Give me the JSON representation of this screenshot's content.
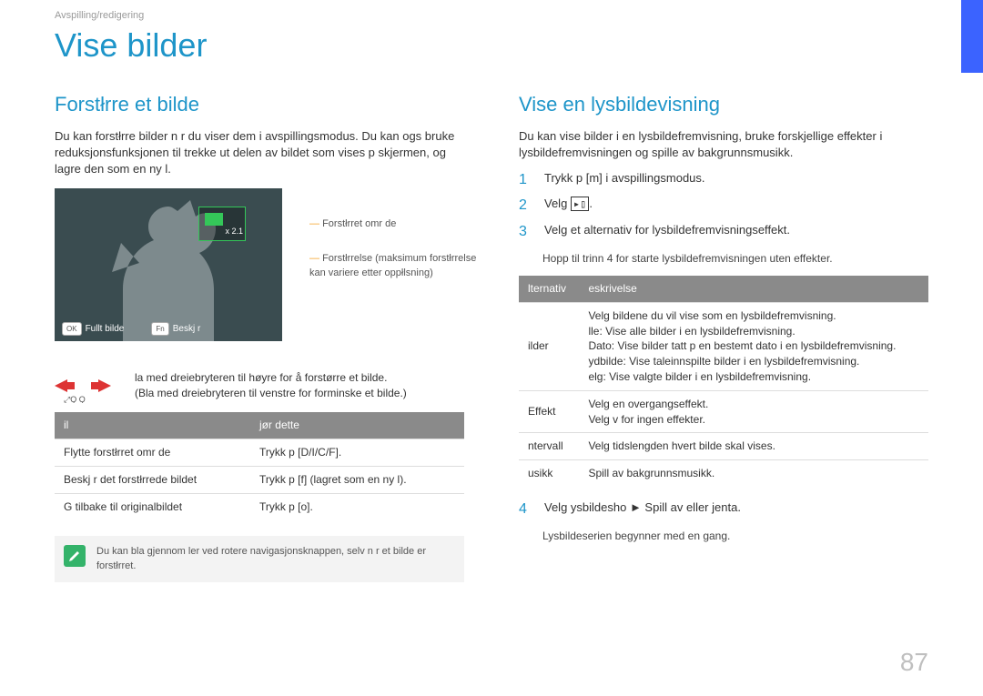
{
  "breadcrumb": "Avspilling/redigering",
  "page_title": "Vise bilder",
  "page_number": "87",
  "left": {
    "heading": "Forstłrre et bilde",
    "intro": "Du kan forstłrre bilder n r du viser dem i avspillingsmodus. Du kan ogs  bruke reduksjonsfunksjonen til   trekke ut delen av bildet som vises p  skjermen, og lagre den som en ny  l.",
    "zoom_ratio": "x 2.1",
    "anno_area": "Forstłrret omr de",
    "anno_mag": "Forstłrrelse (maksimum forstłrrelse kan variere etter oppłlsning)",
    "footer_full_key": "OK",
    "footer_full": "Fullt bilde",
    "footer_crop_key": "Fn",
    "footer_crop": "Beskj r",
    "hint1": "la med dreiebryteren til høyre for å forstørre et bilde.",
    "hint2": "(Bla med dreiebryteren til venstre for   forminske et bilde.)",
    "table_h1": "il",
    "table_h2": "jør dette",
    "r1c1": "Flytte forstłrret omr de",
    "r1c2": "Trykk p  [D/I/C/F].",
    "r2c1": "Beskj r det forstłrrede bildet",
    "r2c2": "Trykk p  [f] (lagret som en ny  l).",
    "r3c1": "G  tilbake til originalbildet",
    "r3c2": "Trykk p  [o].",
    "note": "Du kan bla gjennom  ler ved   rotere navigasjonsknappen, selv n r et bilde er forstłrret."
  },
  "right": {
    "heading": "Vise en lysbildevisning",
    "intro": "Du kan vise bilder i en lysbildefremvisning, bruke forskjellige effekter i lysbildefremvisningen og spille av bakgrunnsmusikk.",
    "s1": "Trykk p  [m] i avspillingsmodus.",
    "s2_pre": "Velg ",
    "s2_icon": "▸▯",
    "s2_post": ".",
    "s3": "Velg et alternativ for lysbildefremvisningseffekt.",
    "s3_sub": "Hopp til trinn 4 for   starte lysbildefremvisningen uten effekter.",
    "th1": "lternativ",
    "th2": "eskrivelse",
    "t_r1a": "ilder",
    "t_r1b1": "Velg bildene du vil vise som en lysbildefremvisning.",
    "t_r1b2": "lle: Vise alle bilder i en lysbildefremvisning.",
    "t_r1b3": "Dato: Vise bilder tatt p  en bestemt dato i en lysbildefremvisning.",
    "t_r1b4": "ydbilde: Vise taleinnspilte bilder i en lysbildefremvisning.",
    "t_r1b5": "elg: Vise valgte bilder i en lysbildefremvisning.",
    "t_r2a": "Effekt",
    "t_r2b1": "Velg en overgangseffekt.",
    "t_r2b2": "Velg v  for ingen effekter.",
    "t_r3a": "ntervall",
    "t_r3b": "Velg tidslengden hvert bilde skal vises.",
    "t_r4a": "usikk",
    "t_r4b": "Spill av bakgrunnsmusikk.",
    "s4": "Velg ysbildesho        ► Spill av eller jenta.",
    "s4_sub": "Lysbildeserien begynner med en gang."
  }
}
